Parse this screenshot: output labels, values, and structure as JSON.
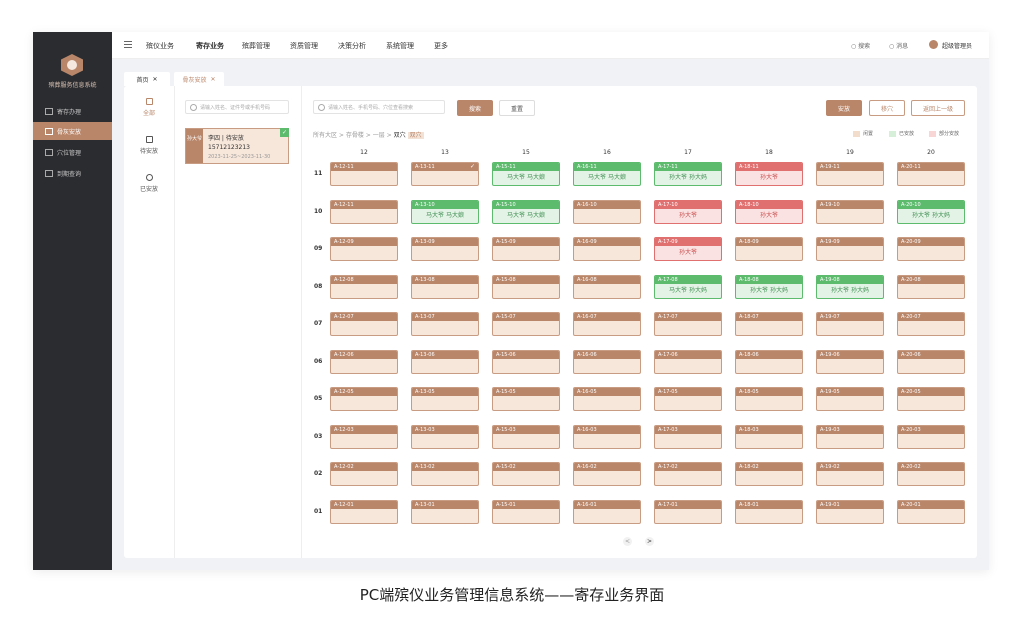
{
  "sidebar": {
    "system_name": "殡葬服务信息系统",
    "items": [
      {
        "label": "寄存办理",
        "icon": "grid-icon",
        "active": false
      },
      {
        "label": "骨灰安放",
        "icon": "user-icon",
        "active": true
      },
      {
        "label": "穴位管理",
        "icon": "layout-icon",
        "active": false
      },
      {
        "label": "到期查询",
        "icon": "image-icon",
        "active": false
      }
    ]
  },
  "topbar": {
    "nav": [
      "殡仪业务",
      "寄存业务",
      "殡葬管理",
      "资质管理",
      "决策分析",
      "系统管理",
      "更多"
    ],
    "active_nav": "寄存业务",
    "search": "搜索",
    "message": "消息",
    "user": "超级管理员"
  },
  "tabs": [
    "首页",
    "骨灰安放"
  ],
  "filters": [
    {
      "label": "全部",
      "icon": "grid-icon",
      "active": true
    },
    {
      "label": "待安放",
      "icon": "inbox-icon",
      "active": false
    },
    {
      "label": "已安放",
      "icon": "check-circle-icon",
      "active": false
    }
  ],
  "person_search": {
    "placeholder": "请输入姓名、证件号或手机号码"
  },
  "person_card": {
    "tag": "孙大爷",
    "name": "李四 | 待安放",
    "phone": "15712123213",
    "date": "2023-11-25~2023-11-30"
  },
  "grid_search": {
    "placeholder": "请输入姓名、手机号码、穴位查看搜索"
  },
  "buttons": {
    "search": "搜索",
    "reset": "重置",
    "place": "安放",
    "move": "移穴",
    "return_prev": "返回上一级"
  },
  "breadcrumb": [
    "所有大区",
    "存骨楼",
    "一层",
    "双穴"
  ],
  "breadcrumb_selected": "双穴",
  "legend": [
    {
      "label": "闲置",
      "color": "#f2dccb"
    },
    {
      "label": "已安放",
      "color": "#d6efd9"
    },
    {
      "label": "部分安放",
      "color": "#f8d6d6"
    }
  ],
  "columns": [
    "12",
    "13",
    "15",
    "16",
    "17",
    "18",
    "19",
    "20"
  ],
  "rows": [
    "11",
    "10",
    "09",
    "08",
    "07",
    "06",
    "05",
    "03",
    "02",
    "01"
  ],
  "cells": [
    [
      {
        "code": "A-12-11",
        "status": "idle",
        "names": ""
      },
      {
        "code": "A-13-11",
        "status": "idle",
        "names": "",
        "checked": true
      },
      {
        "code": "A-15-11",
        "status": "green",
        "names": "马大爷   马大娘"
      },
      {
        "code": "A-16-11",
        "status": "green",
        "names": "马大爷   马大娘"
      },
      {
        "code": "A-17-11",
        "status": "green",
        "names": "孙大爷   孙大妈"
      },
      {
        "code": "A-18-11",
        "status": "red",
        "names": "孙大爷"
      },
      {
        "code": "A-19-11",
        "status": "idle",
        "names": ""
      },
      {
        "code": "A-20-11",
        "status": "idle",
        "names": ""
      }
    ],
    [
      {
        "code": "A-12-11",
        "status": "idle",
        "names": ""
      },
      {
        "code": "A-13-10",
        "status": "green",
        "names": "马大爷   马大娘"
      },
      {
        "code": "A-15-10",
        "status": "green",
        "names": "马大爷   马大娘"
      },
      {
        "code": "A-16-10",
        "status": "idle",
        "names": ""
      },
      {
        "code": "A-17-10",
        "status": "red",
        "names": "孙大爷"
      },
      {
        "code": "A-18-10",
        "status": "red",
        "names": "孙大爷"
      },
      {
        "code": "A-19-10",
        "status": "idle",
        "names": ""
      },
      {
        "code": "A-20-10",
        "status": "green",
        "names": "孙大爷   孙大妈"
      }
    ],
    [
      {
        "code": "A-12-09",
        "status": "idle",
        "names": ""
      },
      {
        "code": "A-13-09",
        "status": "idle",
        "names": ""
      },
      {
        "code": "A-15-09",
        "status": "idle",
        "names": ""
      },
      {
        "code": "A-16-09",
        "status": "idle",
        "names": ""
      },
      {
        "code": "A-17-09",
        "status": "red",
        "names": "孙大爷"
      },
      {
        "code": "A-18-09",
        "status": "idle",
        "names": ""
      },
      {
        "code": "A-19-09",
        "status": "idle",
        "names": ""
      },
      {
        "code": "A-20-09",
        "status": "idle",
        "names": ""
      }
    ],
    [
      {
        "code": "A-12-08",
        "status": "idle",
        "names": ""
      },
      {
        "code": "A-13-08",
        "status": "idle",
        "names": ""
      },
      {
        "code": "A-15-08",
        "status": "idle",
        "names": ""
      },
      {
        "code": "A-16-08",
        "status": "idle",
        "names": ""
      },
      {
        "code": "A-17-08",
        "status": "green",
        "names": "马大爷   孙大妈"
      },
      {
        "code": "A-18-08",
        "status": "green",
        "names": "孙大爷   孙大妈"
      },
      {
        "code": "A-19-08",
        "status": "green",
        "names": "孙大爷   孙大妈"
      },
      {
        "code": "A-20-08",
        "status": "idle",
        "names": ""
      }
    ],
    [
      {
        "code": "A-12-07",
        "status": "idle",
        "names": ""
      },
      {
        "code": "A-13-07",
        "status": "idle",
        "names": ""
      },
      {
        "code": "A-15-07",
        "status": "idle",
        "names": ""
      },
      {
        "code": "A-16-07",
        "status": "idle",
        "names": ""
      },
      {
        "code": "A-17-07",
        "status": "idle",
        "names": ""
      },
      {
        "code": "A-18-07",
        "status": "idle",
        "names": ""
      },
      {
        "code": "A-19-07",
        "status": "idle",
        "names": ""
      },
      {
        "code": "A-20-07",
        "status": "idle",
        "names": ""
      }
    ],
    [
      {
        "code": "A-12-06",
        "status": "idle",
        "names": ""
      },
      {
        "code": "A-13-06",
        "status": "idle",
        "names": ""
      },
      {
        "code": "A-15-06",
        "status": "idle",
        "names": ""
      },
      {
        "code": "A-16-06",
        "status": "idle",
        "names": ""
      },
      {
        "code": "A-17-06",
        "status": "idle",
        "names": ""
      },
      {
        "code": "A-18-06",
        "status": "idle",
        "names": ""
      },
      {
        "code": "A-19-06",
        "status": "idle",
        "names": ""
      },
      {
        "code": "A-20-06",
        "status": "idle",
        "names": ""
      }
    ],
    [
      {
        "code": "A-12-05",
        "status": "idle",
        "names": ""
      },
      {
        "code": "A-13-05",
        "status": "idle",
        "names": ""
      },
      {
        "code": "A-15-05",
        "status": "idle",
        "names": ""
      },
      {
        "code": "A-16-05",
        "status": "idle",
        "names": ""
      },
      {
        "code": "A-17-05",
        "status": "idle",
        "names": ""
      },
      {
        "code": "A-18-05",
        "status": "idle",
        "names": ""
      },
      {
        "code": "A-19-05",
        "status": "idle",
        "names": ""
      },
      {
        "code": "A-20-05",
        "status": "idle",
        "names": ""
      }
    ],
    [
      {
        "code": "A-12-03",
        "status": "idle",
        "names": ""
      },
      {
        "code": "A-13-03",
        "status": "idle",
        "names": ""
      },
      {
        "code": "A-15-03",
        "status": "idle",
        "names": ""
      },
      {
        "code": "A-16-03",
        "status": "idle",
        "names": ""
      },
      {
        "code": "A-17-03",
        "status": "idle",
        "names": ""
      },
      {
        "code": "A-18-03",
        "status": "idle",
        "names": ""
      },
      {
        "code": "A-19-03",
        "status": "idle",
        "names": ""
      },
      {
        "code": "A-20-03",
        "status": "idle",
        "names": ""
      }
    ],
    [
      {
        "code": "A-12-02",
        "status": "idle",
        "names": ""
      },
      {
        "code": "A-13-02",
        "status": "idle",
        "names": ""
      },
      {
        "code": "A-15-02",
        "status": "idle",
        "names": ""
      },
      {
        "code": "A-16-02",
        "status": "idle",
        "names": ""
      },
      {
        "code": "A-17-02",
        "status": "idle",
        "names": ""
      },
      {
        "code": "A-18-02",
        "status": "idle",
        "names": ""
      },
      {
        "code": "A-19-02",
        "status": "idle",
        "names": ""
      },
      {
        "code": "A-20-02",
        "status": "idle",
        "names": ""
      }
    ],
    [
      {
        "code": "A-12-01",
        "status": "idle",
        "names": ""
      },
      {
        "code": "A-13-01",
        "status": "idle",
        "names": ""
      },
      {
        "code": "A-15-01",
        "status": "idle",
        "names": ""
      },
      {
        "code": "A-16-01",
        "status": "idle",
        "names": ""
      },
      {
        "code": "A-17-01",
        "status": "idle",
        "names": ""
      },
      {
        "code": "A-18-01",
        "status": "idle",
        "names": ""
      },
      {
        "code": "A-19-01",
        "status": "idle",
        "names": ""
      },
      {
        "code": "A-20-01",
        "status": "idle",
        "names": ""
      }
    ]
  ],
  "pager": {
    "prev": "<",
    "next": ">"
  },
  "caption": "PC端殡仪业务管理信息系统——寄存业务界面"
}
